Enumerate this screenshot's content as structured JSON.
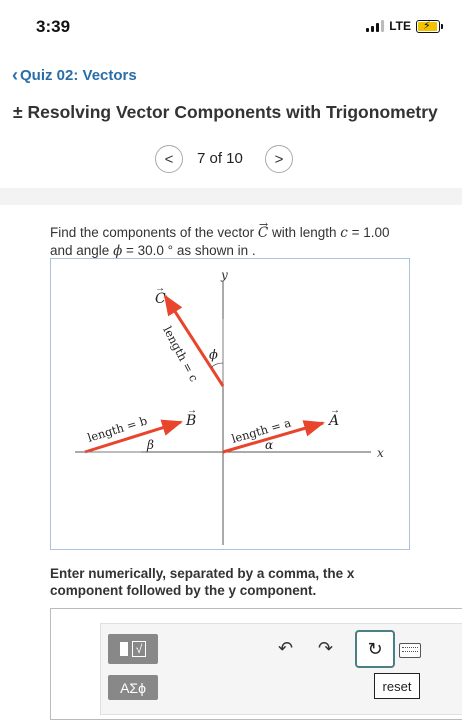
{
  "status_bar": {
    "time": "3:39",
    "network": "LTE",
    "icons": [
      "signal-icon",
      "battery-charging-icon"
    ]
  },
  "nav": {
    "back_label": "Quiz 02: Vectors"
  },
  "problem": {
    "title": "± Resolving Vector Components with Trigonometry"
  },
  "pager": {
    "label": "7 of 10"
  },
  "prompt": {
    "text_1": "Find the components of the vector ",
    "vector": "C",
    "text_2": " with length ",
    "length_var": "c",
    "text_3": " = 1.00 and angle ",
    "angle_var": "ϕ",
    "text_4": " = 30.0 ° as shown in ."
  },
  "figure": {
    "axis_x": "x",
    "axis_y": "y",
    "vector_c": "C",
    "vector_b": "B",
    "vector_a": "A",
    "label_c": "length = c",
    "label_b": "length = b",
    "label_a": "length = a",
    "angle_phi": "ϕ",
    "angle_beta": "β",
    "angle_alpha": "α",
    "vector_color": "#e8452c"
  },
  "instruction": "Enter numerically, separated by a comma, the x component followed by the y component.",
  "toolbar": {
    "template_label": "√",
    "greek_label": "ΑΣϕ",
    "reset_label": "reset",
    "icons": [
      "undo-icon",
      "redo-icon",
      "refresh-icon",
      "keyboard-icon"
    ]
  }
}
